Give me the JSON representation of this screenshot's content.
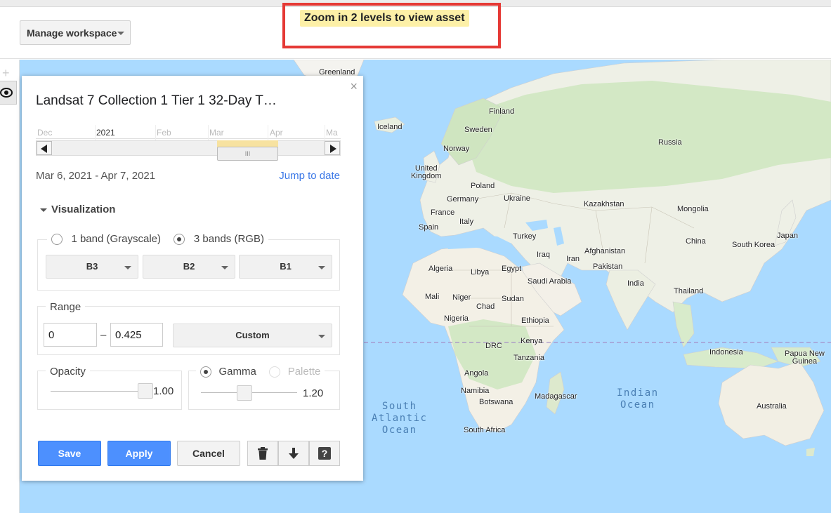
{
  "topbar": {
    "manage_workspace": "Manage workspace",
    "zoom_message": "Zoom in 2 levels to view asset"
  },
  "panel": {
    "title": "Landsat 7 Collection 1 Tier 1 32-Day T…",
    "close": "×",
    "timeline": {
      "labels": [
        "Dec",
        "2021",
        "Feb",
        "Mar",
        "Apr",
        "Ma"
      ],
      "selected_range": "Mar 6, 2021 - Apr 7, 2021"
    },
    "jump_to_date": "Jump to date",
    "visualization": {
      "header": "Visualization",
      "band_mode": {
        "option1": "1 band (Grayscale)",
        "option2": "3 bands (RGB)",
        "selected": "3 bands (RGB)"
      },
      "bands": {
        "red": "B3",
        "green": "B2",
        "blue": "B1"
      },
      "range": {
        "legend": "Range",
        "min": "0",
        "dash": "–",
        "max": "0.425",
        "mode": "Custom"
      },
      "opacity": {
        "legend": "Opacity",
        "value": "1.00",
        "level": 1.0
      },
      "gamma": {
        "option1": "Gamma",
        "option2": "Palette",
        "selected": "Gamma",
        "value": "1.20",
        "level": 0.45
      }
    },
    "buttons": {
      "save": "Save",
      "apply": "Apply",
      "cancel": "Cancel"
    },
    "icon_buttons": [
      "trash-icon",
      "download-icon",
      "help-icon"
    ]
  },
  "map": {
    "labels": [
      {
        "text": "Greenland"
      },
      {
        "text": "Iceland"
      },
      {
        "text": "Finland"
      },
      {
        "text": "Sweden"
      },
      {
        "text": "Norway"
      },
      {
        "text": "Russia"
      },
      {
        "text": "United\nKingdom"
      },
      {
        "text": "Poland"
      },
      {
        "text": "Germany"
      },
      {
        "text": "Ukraine"
      },
      {
        "text": "Kazakhstan"
      },
      {
        "text": "Mongolia"
      },
      {
        "text": "France"
      },
      {
        "text": "Italy"
      },
      {
        "text": "Spain"
      },
      {
        "text": "Turkey"
      },
      {
        "text": "Japan"
      },
      {
        "text": "China"
      },
      {
        "text": "South Korea"
      },
      {
        "text": "Iraq"
      },
      {
        "text": "Iran"
      },
      {
        "text": "Afghanistan"
      },
      {
        "text": "Pakistan"
      },
      {
        "text": "Algeria"
      },
      {
        "text": "Libya"
      },
      {
        "text": "Egypt"
      },
      {
        "text": "Saudi Arabia"
      },
      {
        "text": "India"
      },
      {
        "text": "Thailand"
      },
      {
        "text": "Mali"
      },
      {
        "text": "Niger"
      },
      {
        "text": "Chad"
      },
      {
        "text": "Sudan"
      },
      {
        "text": "Nigeria"
      },
      {
        "text": "Ethiopia"
      },
      {
        "text": "Kenya"
      },
      {
        "text": "DRC"
      },
      {
        "text": "Tanzania"
      },
      {
        "text": "Indonesia"
      },
      {
        "text": "Papua New\nGuinea"
      },
      {
        "text": "Angola"
      },
      {
        "text": "Namibia"
      },
      {
        "text": "Botswana"
      },
      {
        "text": "Madagascar"
      },
      {
        "text": "South Africa"
      },
      {
        "text": "Australia"
      }
    ],
    "oceans": [
      {
        "text": "South\nAtlantic\nOcean"
      },
      {
        "text": "Indian\nOcean"
      }
    ],
    "colors": {
      "water": "#aadaff",
      "land": "#f1efe9",
      "green_land": "#cde6c3",
      "equator": "#a48fc7"
    }
  }
}
